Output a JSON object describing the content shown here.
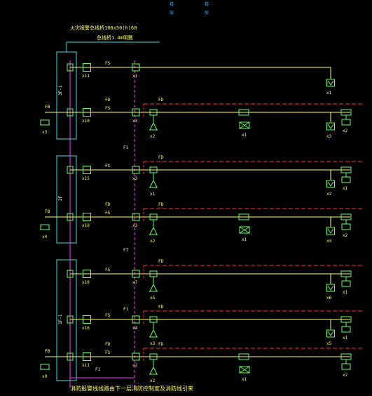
{
  "colors": {
    "background": "#000000",
    "fs_line": "#ffff66",
    "fd_line": "#ff3333",
    "device": "#66ff66",
    "panel": "#33dddd",
    "riser": "#ff33ff",
    "text": "#ffff66"
  },
  "top_labels": [
    "楼",
    "层",
    "楼",
    "层"
  ],
  "title_line1": "火灾报警总线桥100x50(h)60",
  "title_line2": "总线桥1.4m明敷",
  "bottom_note": "消防报警线线路由下一层消防控制室及消防线引来",
  "panels": [
    "3F-1",
    "2F",
    "1F-1"
  ],
  "labels": {
    "fs": "FS",
    "fd": "FD",
    "fb": "FB",
    "f1": "F1",
    "ft": "FT"
  },
  "rows": [
    {
      "id": "r1",
      "module_count": "x11",
      "bus_count": "x1",
      "end_count": "x1"
    },
    {
      "id": "r2",
      "module_count": "x10",
      "bus_count": "x3",
      "fb_count": "x3",
      "c1": "x2",
      "c2": "x1",
      "c3": "x3",
      "c4": "x2"
    },
    {
      "id": "r3",
      "module_count": "x15",
      "bus_count": "x2",
      "c1": "x1",
      "c3": "x2",
      "c4": "x1"
    },
    {
      "id": "r4",
      "module_count": "x10",
      "bus_count": "x3",
      "fb_count": "x4",
      "c1": "x2",
      "c2": "x1",
      "c3": "x3",
      "c4": "x2"
    },
    {
      "id": "r5",
      "module_count": "x10",
      "bus_count": "x7",
      "c1": "x5",
      "c3": "x6",
      "c4": "x1"
    },
    {
      "id": "r6",
      "module_count": "x16",
      "bus_count": "x4",
      "c1": "x3",
      "c3": "x5",
      "c4": "x1"
    },
    {
      "id": "r7",
      "module_count": "x11",
      "bus_count": "x2",
      "fb_count": "x9",
      "c1": "x2",
      "c2": "x1",
      "c4": "x2"
    }
  ]
}
